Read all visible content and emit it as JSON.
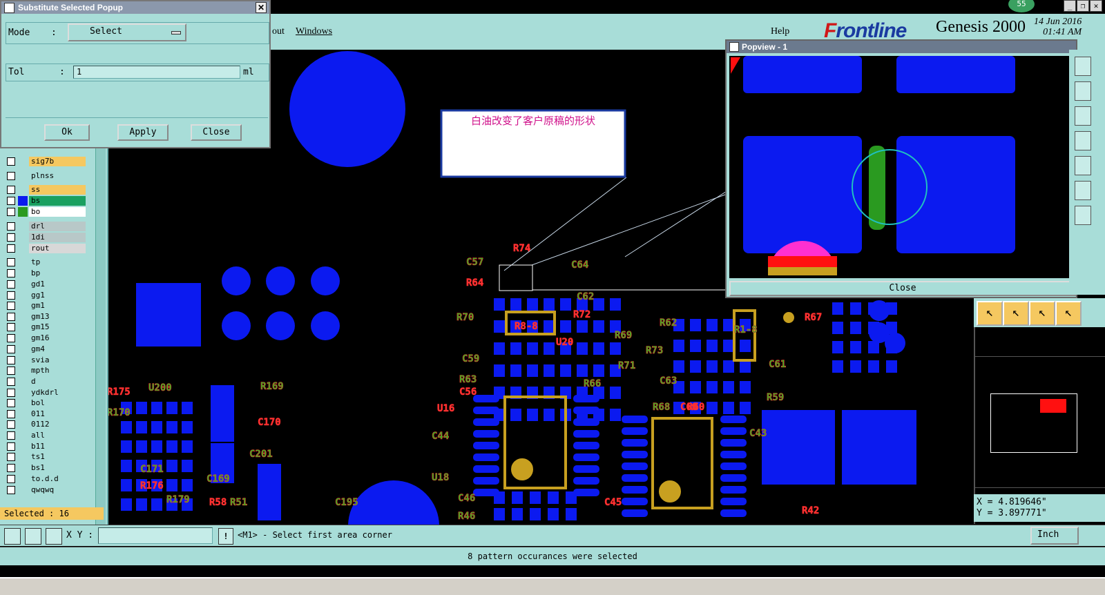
{
  "popup": {
    "title": "Substitute Selected Popup",
    "mode_label": "Mode",
    "mode_colon": ":",
    "mode_value": "Select",
    "tol_label": "Tol",
    "tol_colon": ":",
    "tol_value": "1",
    "tol_unit": "ml",
    "ok_label": "Ok",
    "apply_label": "Apply",
    "close_label": "Close"
  },
  "menubar": {
    "partial_menu": "out",
    "windows_menu": "Windows",
    "help_menu": "Help"
  },
  "brand": {
    "logo_f": "F",
    "logo_rest": "rontline",
    "product": "Genesis 2000",
    "date": "14 Jun 2016",
    "time": "01:41 AM",
    "badge": "55"
  },
  "layers": [
    {
      "name": "sig7b",
      "swatch": "",
      "bg": "#f5c860"
    },
    {
      "name": "plnss",
      "swatch": "",
      "bg": "#a8ddd8"
    },
    {
      "name": "ss",
      "swatch": "",
      "bg": "#f5c860"
    },
    {
      "name": "bs",
      "swatch": "#0b1af0",
      "bg": "#1aa060"
    },
    {
      "name": "bo",
      "swatch": "#2a9a20",
      "bg": "#ffffff"
    },
    {
      "name": "drl",
      "swatch": "",
      "bg": "#b8c8c8"
    },
    {
      "name": "1di",
      "swatch": "",
      "bg": "#b8c8c8"
    },
    {
      "name": "rout",
      "swatch": "",
      "bg": "#d8d8d8"
    },
    {
      "name": "tp",
      "swatch": "",
      "bg": "#a8ddd8"
    },
    {
      "name": "bp",
      "swatch": "",
      "bg": "#a8ddd8"
    },
    {
      "name": "gd1",
      "swatch": "",
      "bg": "#a8ddd8"
    },
    {
      "name": "gg1",
      "swatch": "",
      "bg": "#a8ddd8"
    },
    {
      "name": "gm1",
      "swatch": "",
      "bg": "#a8ddd8"
    },
    {
      "name": "gm13",
      "swatch": "",
      "bg": "#a8ddd8"
    },
    {
      "name": "gm15",
      "swatch": "",
      "bg": "#a8ddd8"
    },
    {
      "name": "gm16",
      "swatch": "",
      "bg": "#a8ddd8"
    },
    {
      "name": "gm4",
      "swatch": "",
      "bg": "#a8ddd8"
    },
    {
      "name": "svia",
      "swatch": "",
      "bg": "#a8ddd8"
    },
    {
      "name": "mpth",
      "swatch": "",
      "bg": "#a8ddd8"
    },
    {
      "name": "d",
      "swatch": "",
      "bg": "#a8ddd8"
    },
    {
      "name": "ydkdrl",
      "swatch": "",
      "bg": "#a8ddd8"
    },
    {
      "name": "bol",
      "swatch": "",
      "bg": "#a8ddd8"
    },
    {
      "name": "011",
      "swatch": "",
      "bg": "#a8ddd8"
    },
    {
      "name": "0112",
      "swatch": "",
      "bg": "#a8ddd8"
    },
    {
      "name": "all",
      "swatch": "",
      "bg": "#a8ddd8"
    },
    {
      "name": "b11",
      "swatch": "",
      "bg": "#a8ddd8"
    },
    {
      "name": "ts1",
      "swatch": "",
      "bg": "#a8ddd8"
    },
    {
      "name": "bs1",
      "swatch": "",
      "bg": "#a8ddd8"
    },
    {
      "name": "to.d.d",
      "swatch": "",
      "bg": "#a8ddd8"
    },
    {
      "name": "qwqwq",
      "swatch": "",
      "bg": "#a8ddd8"
    }
  ],
  "selected_text": "Selected : 16",
  "annotation": "白油改变了客户原稿的形状",
  "popview": {
    "title": "Popview - 1",
    "close_label": "Close"
  },
  "coords": {
    "x": "X = 4.819646\"",
    "y": "Y = 3.897771\""
  },
  "cmd": {
    "xy_label": "X Y :",
    "xy_value": "",
    "prompt": "<M1> - Select first area corner",
    "units": "Inch"
  },
  "status": "8 pattern occurances were selected",
  "pcb_labels": [
    "R74",
    "C57",
    "C64",
    "R64",
    "C62",
    "R70",
    "R72",
    "R69",
    "R62",
    "R67",
    "R73",
    "C59",
    "U20",
    "R71",
    "R63",
    "C56",
    "R66",
    "C63",
    "C60",
    "R59",
    "C61",
    "U16",
    "C44",
    "R68",
    "R60",
    "U18",
    "C43",
    "C45",
    "C46",
    "R46",
    "R42",
    "U200",
    "R169",
    "C170",
    "C201",
    "C171",
    "R176",
    "R179",
    "C169",
    "R58",
    "R51",
    "C195",
    "R175",
    "R170",
    "R1-8",
    "R8-8"
  ],
  "colors": {
    "panel": "#a8ddd8",
    "pad_blue": "#0b1af0",
    "silk_gold": "#c8a020",
    "label_red": "#ff3030",
    "label_green": "#20c020",
    "highlight": "#f5c860"
  }
}
